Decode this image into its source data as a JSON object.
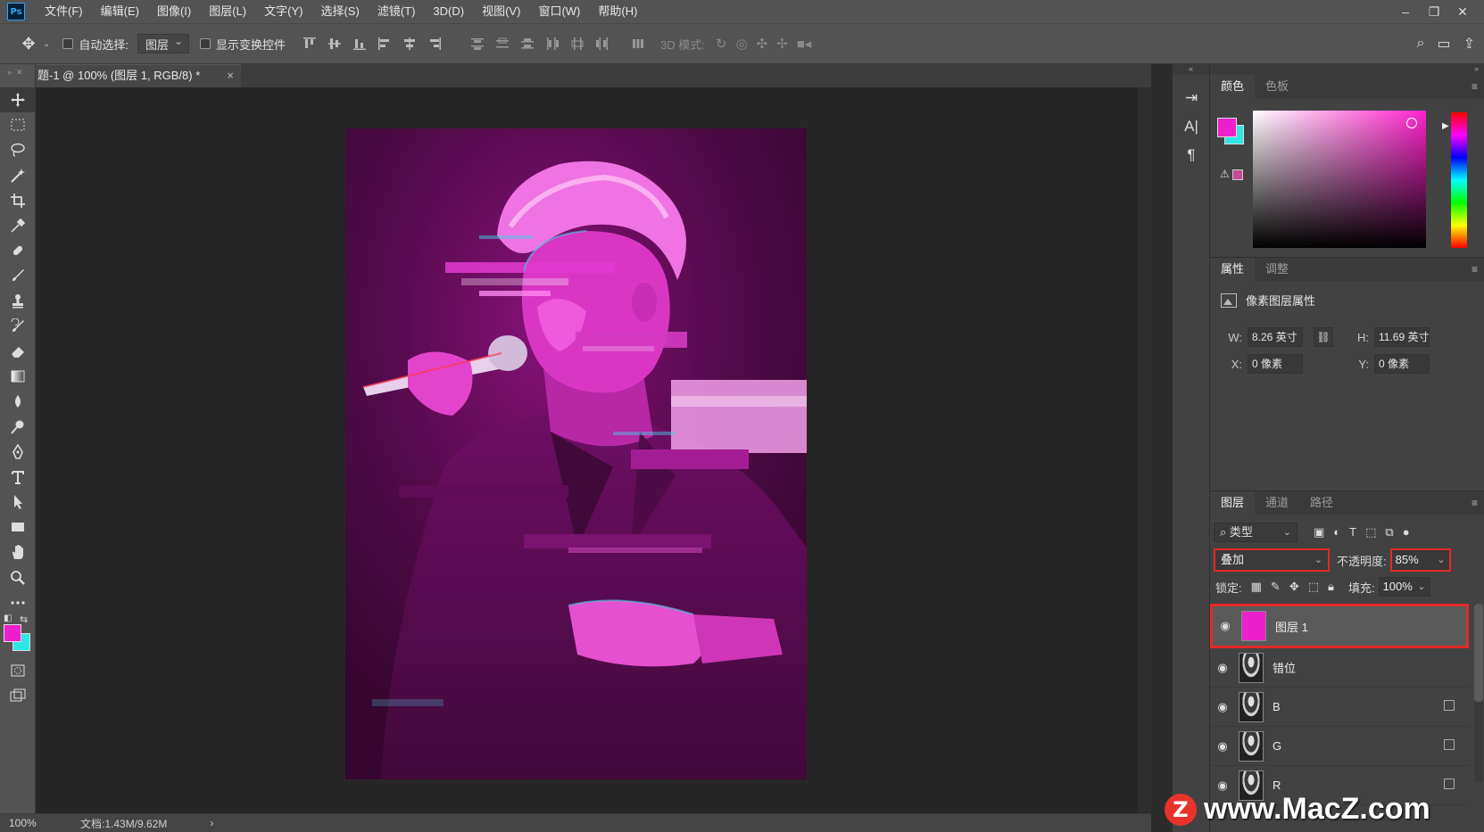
{
  "menubar": {
    "logo": "Ps",
    "items": [
      "文件(F)",
      "编辑(E)",
      "图像(I)",
      "图层(L)",
      "文字(Y)",
      "选择(S)",
      "滤镜(T)",
      "3D(D)",
      "视图(V)",
      "窗口(W)",
      "帮助(H)"
    ]
  },
  "options": {
    "auto_select_label": "自动选择:",
    "auto_select_value": "图层",
    "show_transform_label": "显示变换控件",
    "mode_3d_label": "3D 模式:"
  },
  "document": {
    "tab_title": "题-1 @ 100% (图层 1, RGB/8) *",
    "close": "×"
  },
  "status": {
    "zoom": "100%",
    "doc_size": "文档:1.43M/9.62M",
    "arrow": "›"
  },
  "color_panel": {
    "tabs": [
      "颜色",
      "色板"
    ],
    "foreground": "#ee20cc",
    "background": "#2ee6e6"
  },
  "properties_panel": {
    "tabs": [
      "属性",
      "调整"
    ],
    "title": "像素图层属性",
    "w_label": "W:",
    "w_value": "8.26 英寸",
    "h_label": "H:",
    "h_value": "11.69 英寸",
    "x_label": "X:",
    "x_value": "0 像素",
    "y_label": "Y:",
    "y_value": "0 像素"
  },
  "layers_panel": {
    "tabs": [
      "图层",
      "通道",
      "路径"
    ],
    "filter_kind": "类型",
    "blend_mode": "叠加",
    "opacity_label": "不透明度:",
    "opacity_value": "85%",
    "lock_label": "锁定:",
    "fill_label": "填充:",
    "fill_value": "100%",
    "layers": [
      {
        "name": "图层 1",
        "thumb": "#ee20cc",
        "selected": true
      },
      {
        "name": "错位"
      },
      {
        "name": "B"
      },
      {
        "name": "G"
      },
      {
        "name": "R"
      }
    ]
  },
  "accent_colors": {
    "highlight_red": "#e5282a",
    "magenta": "#ee20cc",
    "cyan": "#2ee6e6"
  },
  "watermark": {
    "logo": "Z",
    "text": "www.MacZ.com"
  }
}
